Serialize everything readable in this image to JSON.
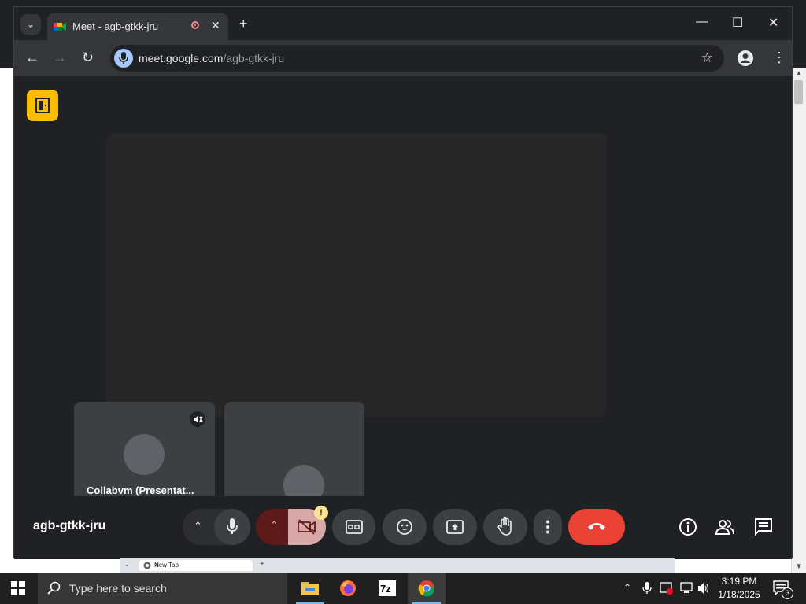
{
  "browser": {
    "tab_title": "Meet - agb-gtkk-jru",
    "tab_close": "✕",
    "new_tab": "+",
    "url_host": "meet.google.com",
    "url_path": "/agb-gtkk-jru",
    "window_controls": {
      "minimize": "—",
      "maximize": "☐",
      "close": "✕"
    }
  },
  "meet": {
    "meeting_code": "agb-gtkk-jru",
    "participants": [
      {
        "name": "Collabvm (Presentat...",
        "muted": true
      },
      {
        "name": ""
      }
    ],
    "camera_warning": "!"
  },
  "lower_browser": {
    "tab_title": "New Tab"
  },
  "taskbar": {
    "search_placeholder": "Type here to search",
    "time": "3:19 PM",
    "date": "1/18/2025",
    "notification_count": "3"
  },
  "icons": [
    "chevron-down-icon",
    "meet-favicon",
    "recording-icon",
    "close-icon",
    "plus-icon",
    "back-arrow-icon",
    "forward-arrow-icon",
    "reload-icon",
    "mic-icon",
    "star-icon",
    "profile-icon",
    "more-vert-icon",
    "door-exit-icon",
    "mic-off-icon",
    "camera-off-icon",
    "captions-icon",
    "emoji-icon",
    "present-icon",
    "raise-hand-icon",
    "end-call-icon",
    "info-icon",
    "people-icon",
    "chat-icon",
    "windows-icon",
    "search-icon",
    "file-explorer-icon",
    "firefox-icon",
    "7zip-icon",
    "chrome-icon"
  ],
  "colors": {
    "meet_bg": "#202124",
    "end_call": "#ea4335",
    "camera_off_bg": "#d8a8a8",
    "accent_yellow": "#fbbc04"
  }
}
